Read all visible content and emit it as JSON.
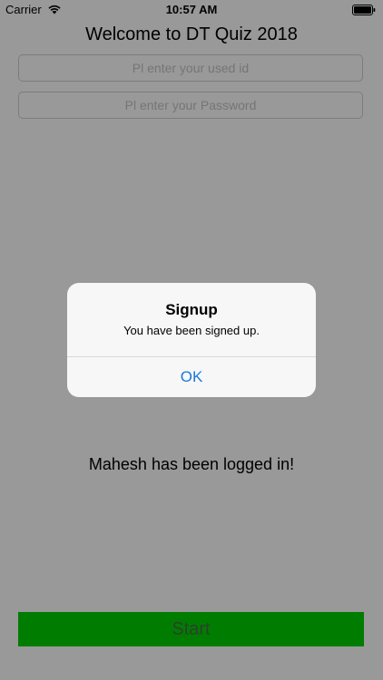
{
  "status_bar": {
    "carrier": "Carrier",
    "time": "10:57 AM",
    "wifi_icon": "wifi-icon",
    "battery_icon": "battery-icon"
  },
  "page": {
    "title": "Welcome to DT Quiz 2018",
    "userid_placeholder": "Pl enter your used id",
    "password_placeholder": "Pl enter your Password",
    "logged_in_message": "Mahesh has been logged in!",
    "start_label": "Start"
  },
  "alert": {
    "title": "Signup",
    "message": "You have been signed up.",
    "ok_label": "OK"
  },
  "colors": {
    "start_button": "#00d000",
    "alert_button_text": "#1a78d8",
    "overlay": "#000000"
  }
}
